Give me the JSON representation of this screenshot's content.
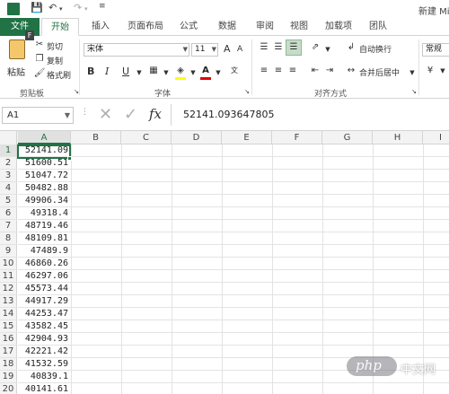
{
  "window": {
    "title": "新建 Mi"
  },
  "quick_access": {
    "save_icon": "save-icon",
    "undo_icon": "undo-icon",
    "redo_icon": "redo-icon"
  },
  "tabs": [
    {
      "label": "文件"
    },
    {
      "label": "开始"
    },
    {
      "label": "插入"
    },
    {
      "label": "页面布局"
    },
    {
      "label": "公式"
    },
    {
      "label": "数据"
    },
    {
      "label": "审阅"
    },
    {
      "label": "视图"
    },
    {
      "label": "加载项"
    },
    {
      "label": "团队"
    }
  ],
  "key_tips": {
    "file": "F"
  },
  "ribbon": {
    "clipboard": {
      "paste": "粘贴",
      "cut": "剪切",
      "copy": "复制",
      "format_painter": "格式刷",
      "label": "剪贴板"
    },
    "font": {
      "name": "宋体",
      "size": "11",
      "bold": "B",
      "italic": "I",
      "underline": "U",
      "label": "字体",
      "grow": "A",
      "shrink": "A"
    },
    "alignment": {
      "wrap_text": "自动换行",
      "merge_center": "合并后居中",
      "label": "对齐方式"
    },
    "number": {
      "format": "常规"
    }
  },
  "formula_bar": {
    "name_box": "A1",
    "fx": "fx",
    "content": "52141.093647805"
  },
  "columns": [
    "A",
    "B",
    "C",
    "D",
    "E",
    "F",
    "G",
    "H",
    "I"
  ],
  "rows": [
    {
      "num": "1",
      "a": "52141.09"
    },
    {
      "num": "2",
      "a": "51600.51"
    },
    {
      "num": "3",
      "a": "51047.72"
    },
    {
      "num": "4",
      "a": "50482.88"
    },
    {
      "num": "5",
      "a": "49906.34"
    },
    {
      "num": "6",
      "a": "49318.4"
    },
    {
      "num": "7",
      "a": "48719.46"
    },
    {
      "num": "8",
      "a": "48109.81"
    },
    {
      "num": "9",
      "a": "47489.9"
    },
    {
      "num": "10",
      "a": "46860.26"
    },
    {
      "num": "11",
      "a": "46297.06"
    },
    {
      "num": "12",
      "a": "45573.44"
    },
    {
      "num": "13",
      "a": "44917.29"
    },
    {
      "num": "14",
      "a": "44253.47"
    },
    {
      "num": "15",
      "a": "43582.45"
    },
    {
      "num": "16",
      "a": "42904.93"
    },
    {
      "num": "17",
      "a": "42221.42"
    },
    {
      "num": "18",
      "a": "41532.59"
    },
    {
      "num": "19",
      "a": "40839.1"
    },
    {
      "num": "20",
      "a": "40141.61"
    }
  ],
  "watermark": {
    "brand": "php",
    "text": "中文网"
  },
  "colors": {
    "accent": "#217346"
  }
}
